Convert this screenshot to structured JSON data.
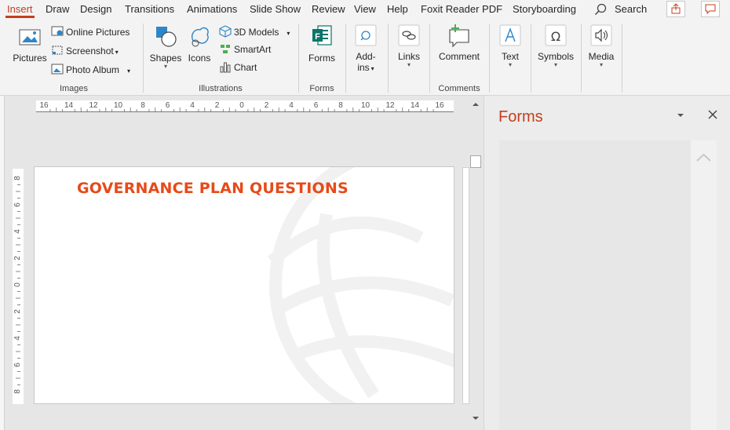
{
  "tabs": [
    "Insert",
    "Draw",
    "Design",
    "Transitions",
    "Animations",
    "Slide Show",
    "Review",
    "View",
    "Help",
    "Foxit Reader PDF",
    "Storyboarding"
  ],
  "search": {
    "label": "Search"
  },
  "ribbon": {
    "images": {
      "pictures": "Pictures",
      "online_pictures": "Online Pictures",
      "screenshot": "Screenshot",
      "photo_album": "Photo Album",
      "group_label": "Images"
    },
    "illustrations": {
      "shapes": "Shapes",
      "icons": "Icons",
      "models_3d": "3D Models",
      "smartart": "SmartArt",
      "chart": "Chart",
      "group_label": "Illustrations"
    },
    "forms": {
      "forms": "Forms",
      "group_label": "Forms"
    },
    "addins": {
      "line1": "Add-",
      "line2": "ins"
    },
    "links": {
      "label": "Links"
    },
    "comments": {
      "comment": "Comment",
      "group_label": "Comments"
    },
    "text": {
      "label": "Text"
    },
    "symbols": {
      "label": "Symbols"
    },
    "media": {
      "label": "Media"
    }
  },
  "ruler_h": [
    "16",
    "14",
    "12",
    "10",
    "8",
    "6",
    "4",
    "2",
    "0",
    "2",
    "4",
    "6",
    "8",
    "10",
    "12",
    "14",
    "16"
  ],
  "ruler_v": [
    "8",
    "6",
    "4",
    "2",
    "0",
    "2",
    "4",
    "6",
    "8"
  ],
  "slide": {
    "title": "GOVERNANCE PLAN QUESTIONS"
  },
  "forms_pane": {
    "title": "Forms"
  },
  "colors": {
    "accent": "#c43e1c",
    "title": "#e64a19"
  }
}
